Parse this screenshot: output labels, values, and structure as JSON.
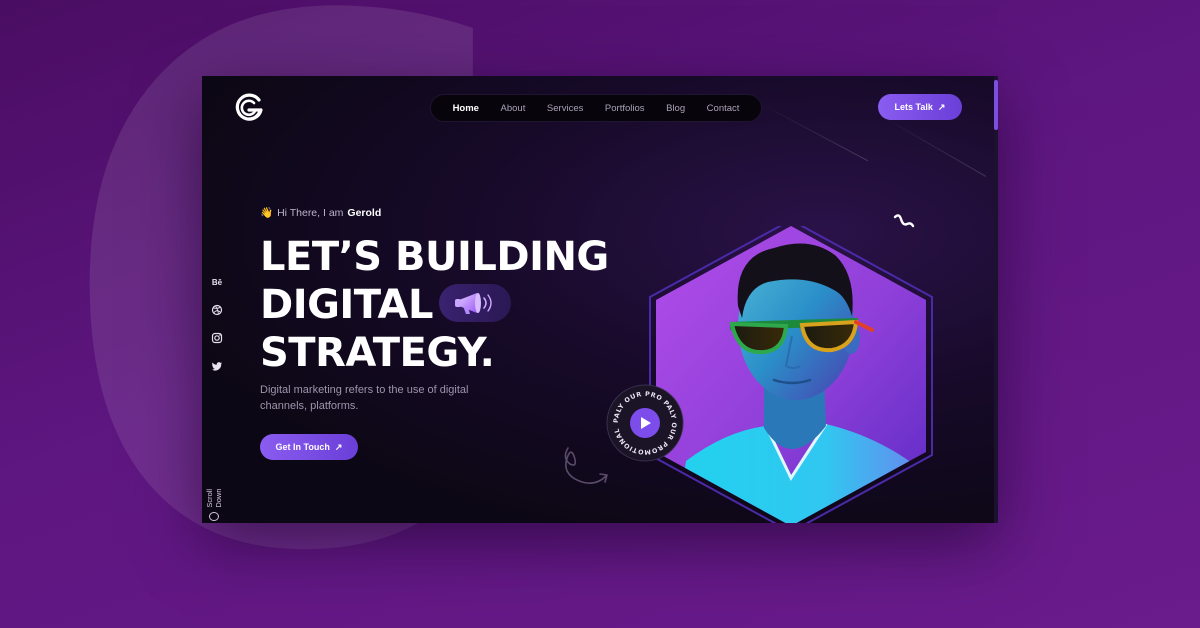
{
  "brand": {
    "logo_icon": "g-logo-icon",
    "accent": "#7c4dea",
    "bg_purple": "#5e1680",
    "hero_bg": "#0c0714"
  },
  "nav": {
    "items": [
      {
        "label": "Home",
        "active": true
      },
      {
        "label": "About",
        "active": false
      },
      {
        "label": "Services",
        "active": false
      },
      {
        "label": "Portfolios",
        "active": false
      },
      {
        "label": "Blog",
        "active": false
      },
      {
        "label": "Contact",
        "active": false
      }
    ],
    "cta_label": "Lets Talk"
  },
  "socials": [
    "Bē",
    "dribbble-icon",
    "instagram-icon",
    "twitter-icon"
  ],
  "scroll": {
    "label": "Scroll Down"
  },
  "hero": {
    "greeting_prefix": "Hi There, I am",
    "greeting_name": "Gerold",
    "headline_line1": "LET’S BUILDING",
    "headline_line2": "DIGITAL",
    "headline_line3": "STRATEGY.",
    "description": "Digital marketing refers to the use of digital channels, platforms.",
    "cta_label": "Get In Touch"
  },
  "video_badge": {
    "ring_text": "PALY OUR PRO PALY OUR PROMOTIONAL VIDEO "
  }
}
